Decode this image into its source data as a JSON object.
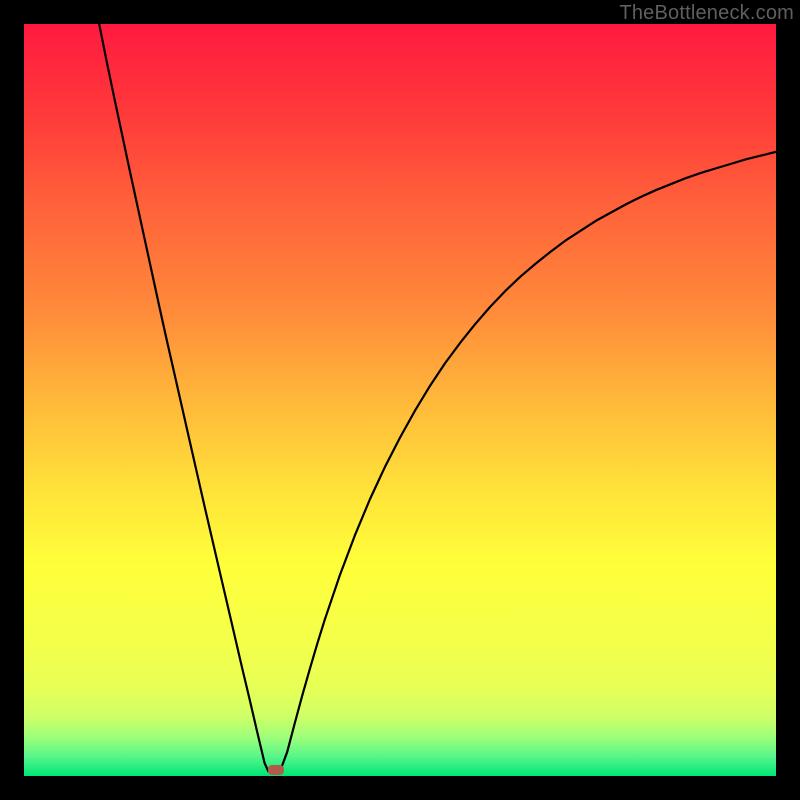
{
  "watermark": "TheBottleneck.com",
  "chart_data": {
    "type": "line",
    "title": "",
    "xlabel": "",
    "ylabel": "",
    "xlim": [
      0,
      100
    ],
    "ylim": [
      0,
      100
    ],
    "background_gradient": {
      "top_color": "#ff1a3f",
      "mid_colors": [
        "#ff643a",
        "#ffb83a",
        "#ffe23a",
        "#ffff3a",
        "#e0ff60",
        "#9aff7a"
      ],
      "bottom_color": "#00e676"
    },
    "curve": {
      "description": "V-shaped bottleneck curve reaching minimum near x≈32",
      "min_x": 32,
      "min_y": 0,
      "left_branch_start": {
        "x": 10,
        "y": 100
      },
      "right_branch_end": {
        "x": 100,
        "y": 82
      }
    },
    "marker": {
      "x": 33.5,
      "y": 0.8,
      "color": "#b35a4a",
      "shape": "rounded-rect"
    },
    "series": [
      {
        "name": "curve",
        "x": [
          10.0,
          11.0,
          12.0,
          13.0,
          14.0,
          15.0,
          16.0,
          17.0,
          18.0,
          19.0,
          20.0,
          21.0,
          22.0,
          23.0,
          24.0,
          25.0,
          26.0,
          27.0,
          28.0,
          29.0,
          30.0,
          31.0,
          32.0,
          32.5,
          33.2,
          34.0,
          35.0,
          36.0,
          37.0,
          38.0,
          39.0,
          40.0,
          42.0,
          44.0,
          46.0,
          48.0,
          50.0,
          52.0,
          54.0,
          56.0,
          58.0,
          60.0,
          62.0,
          64.0,
          66.0,
          68.0,
          70.0,
          72.0,
          74.0,
          76.0,
          78.0,
          80.0,
          82.0,
          84.0,
          86.0,
          88.0,
          90.0,
          92.0,
          94.0,
          96.0,
          98.0,
          100.0
        ],
        "y": [
          100.0,
          95.0,
          90.2,
          85.5,
          80.8,
          76.2,
          71.6,
          67.0,
          62.4,
          57.9,
          53.5,
          49.1,
          44.7,
          40.3,
          35.9,
          31.6,
          27.3,
          23.0,
          18.7,
          14.4,
          10.2,
          5.9,
          1.7,
          0.6,
          0.4,
          0.5,
          3.2,
          7.0,
          10.7,
          14.2,
          17.6,
          20.8,
          26.7,
          32.0,
          36.8,
          41.1,
          45.0,
          48.6,
          51.9,
          54.9,
          57.6,
          60.1,
          62.4,
          64.5,
          66.4,
          68.1,
          69.7,
          71.2,
          72.5,
          73.8,
          74.9,
          76.0,
          77.0,
          77.9,
          78.7,
          79.5,
          80.2,
          80.8,
          81.4,
          82.0,
          82.5,
          83.0
        ]
      }
    ]
  }
}
